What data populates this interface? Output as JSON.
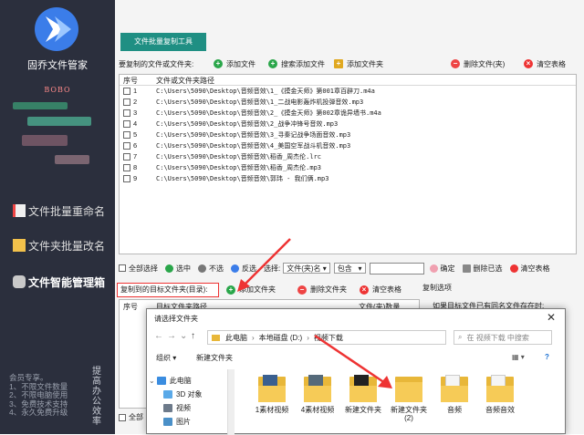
{
  "sidebar": {
    "app_name": "固乔文件管家",
    "user_name": "BOBO",
    "nav": [
      {
        "label": "文件批量重命名"
      },
      {
        "label": "文件夹批量改名"
      },
      {
        "label": "文件智能管理箱"
      }
    ],
    "notes": [
      "会员专享。",
      "1、不限文件数量",
      "2、不限电脑使用",
      "3、免费技术支持",
      "4、永久免费升级"
    ],
    "vertical_text": "提高办公效率"
  },
  "toolbar": {
    "tab_label": "文件批量复制工具",
    "files_label": "要复制的文件或文件夹:",
    "add_file": "添加文件",
    "search_add": "搜索添加文件",
    "add_folder": "添加文件夹",
    "delete_file": "删除文件(夹)",
    "clear_table": "清空表格"
  },
  "filelist": {
    "headers": {
      "idx": "序号",
      "path": "文件或文件夹路径"
    },
    "rows": [
      {
        "idx": "1",
        "path": "C:\\Users\\5090\\Desktop\\音频音效\\1_《摸金天师》第001章百辟刀.m4a"
      },
      {
        "idx": "2",
        "path": "C:\\Users\\5090\\Desktop\\音频音效\\1_二战电影轰炸机投弹音效.mp3"
      },
      {
        "idx": "3",
        "path": "C:\\Users\\5090\\Desktop\\音频音效\\2_《摸金天师》第002章诡异墙书.m4a"
      },
      {
        "idx": "4",
        "path": "C:\\Users\\5090\\Desktop\\音频音效\\2_战争冲锋号音效.mp3"
      },
      {
        "idx": "5",
        "path": "C:\\Users\\5090\\Desktop\\音频音效\\3_寻秦记战争场面音效.mp3"
      },
      {
        "idx": "6",
        "path": "C:\\Users\\5090\\Desktop\\音频音效\\4_美国空军战斗机音效.mp3"
      },
      {
        "idx": "7",
        "path": "C:\\Users\\5090\\Desktop\\音频音效\\稻香_周杰伦.lrc"
      },
      {
        "idx": "8",
        "path": "C:\\Users\\5090\\Desktop\\音频音效\\稻香_周杰伦.mp3"
      },
      {
        "idx": "9",
        "path": "C:\\Users\\5090\\Desktop\\音频音效\\郭玮 - 我们俩.mp3"
      }
    ]
  },
  "selbar": {
    "select_all": "全部选择",
    "select_checked": "选中",
    "unselect": "不选",
    "invert": "反选",
    "select_by": "选择:",
    "by_option": "文件(夹)名",
    "match_option": "包含",
    "confirm": "确定",
    "delete_selected": "删除已选",
    "clear_table": "清空表格"
  },
  "dest": {
    "label": "复制到的目标文件夹(目录):",
    "add_folder": "添加文件夹",
    "delete_folder": "删除文件夹",
    "clear_table": "清空表格",
    "copy_options": "复制选项",
    "copy_option_text": "如果目标文件已有同名文件存在时:",
    "col_path": "目标文件夹路径",
    "col_count": "文件(夹)数量",
    "select_all": "全部"
  },
  "dialog": {
    "title": "请选择文件夹",
    "close": "✕",
    "breadcrumb": [
      "此电脑",
      "本地磁盘 (D:)",
      "视频下载"
    ],
    "search_placeholder": "在 视频下载 中搜索",
    "organize": "组织 ▾",
    "new_folder": "新建文件夹",
    "tree": [
      "此电脑",
      "3D 对象",
      "视频",
      "图片"
    ],
    "folders": [
      {
        "name": "1素材视频"
      },
      {
        "name": "4素材视频"
      },
      {
        "name": "新建文件夹"
      },
      {
        "name": "新建文件夹\n(2)"
      },
      {
        "name": "音频"
      },
      {
        "name": "音频音效"
      }
    ]
  },
  "colors": {
    "sidebar_bg": "#2b2f3d",
    "tab_bg": "#1f8f83",
    "highlight": "#e33333",
    "folder": "#f6cb57"
  }
}
